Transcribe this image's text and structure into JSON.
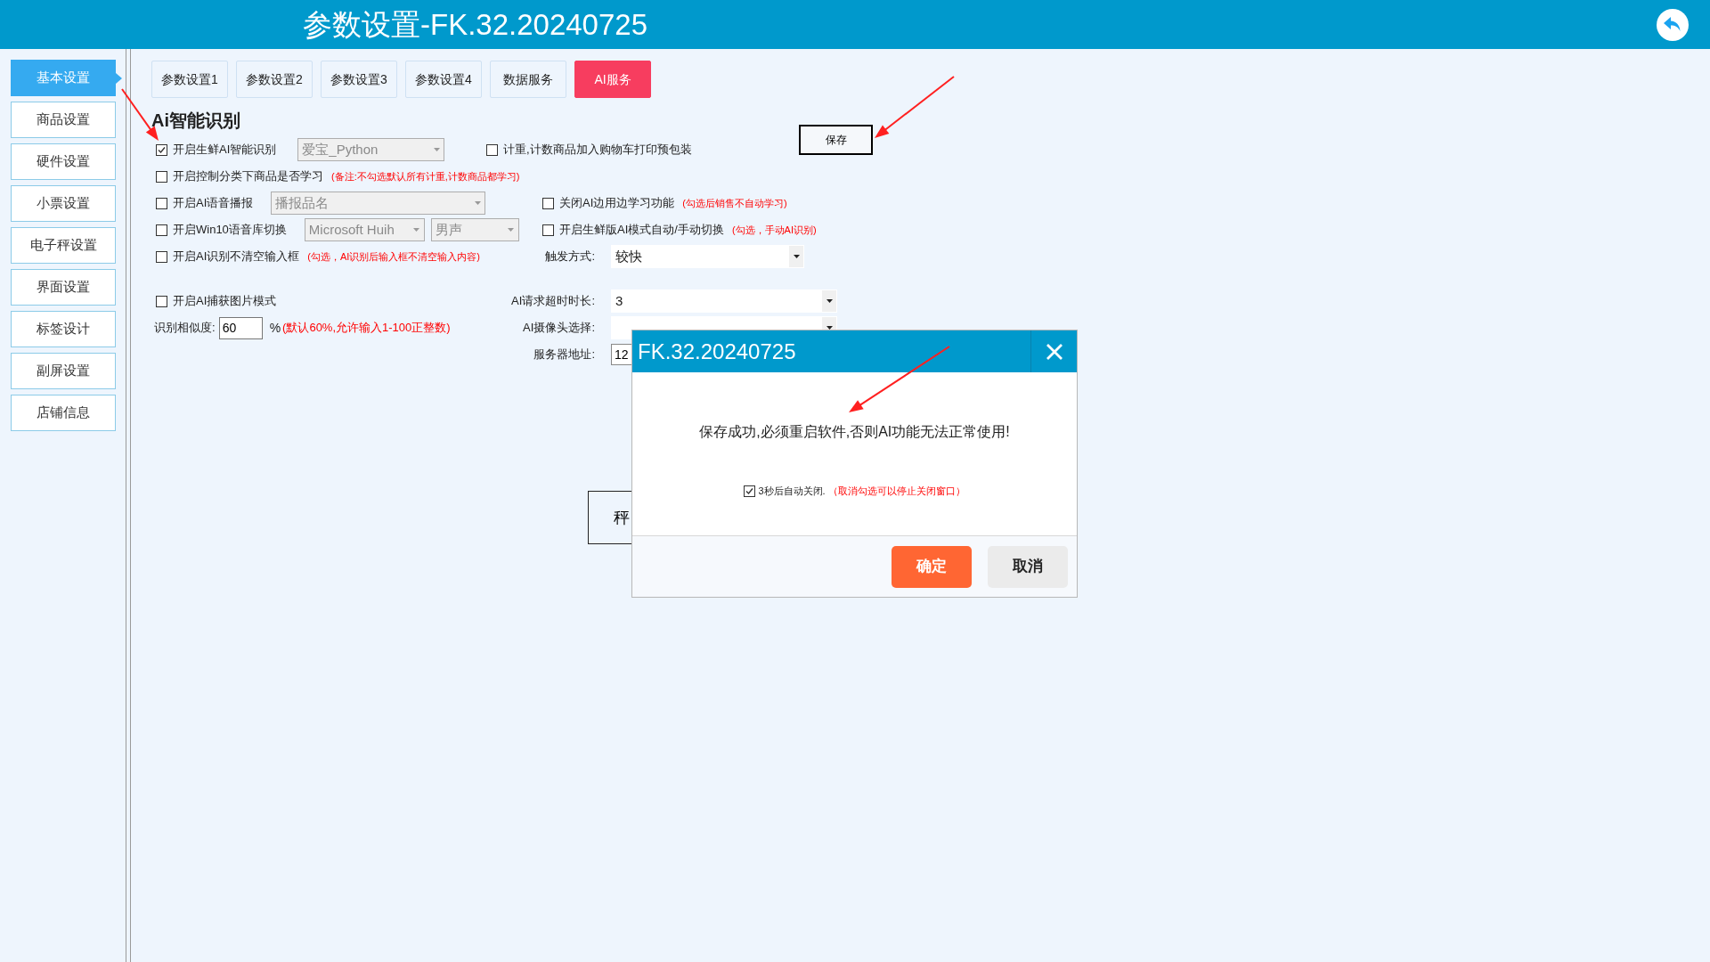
{
  "window": {
    "title": "参数设置-FK.32.20240725"
  },
  "sidebar": {
    "items": [
      {
        "label": "基本设置",
        "selected": true
      },
      {
        "label": "商品设置",
        "selected": false
      },
      {
        "label": "硬件设置",
        "selected": false
      },
      {
        "label": "小票设置",
        "selected": false
      },
      {
        "label": "电子秤设置",
        "selected": false
      },
      {
        "label": "界面设置",
        "selected": false
      },
      {
        "label": "标签设计",
        "selected": false
      },
      {
        "label": "副屏设置",
        "selected": false
      },
      {
        "label": "店铺信息",
        "selected": false
      }
    ]
  },
  "tabs": [
    {
      "label": "参数设置1",
      "selected": false
    },
    {
      "label": "参数设置2",
      "selected": false
    },
    {
      "label": "参数设置3",
      "selected": false
    },
    {
      "label": "参数设置4",
      "selected": false
    },
    {
      "label": "数据服务",
      "selected": false
    },
    {
      "label": "AI服务",
      "selected": true
    }
  ],
  "form": {
    "title": "Ai智能识别",
    "save_button": "保存",
    "rows": [
      {
        "left": {
          "kind": "checkbox",
          "label": "开启生鲜AI智能识别",
          "checked": true,
          "selects": [
            {
              "value": "爱宝_Python",
              "disabled": true
            }
          ]
        },
        "right": {
          "kind": "checkbox",
          "label": "计重,计数商品加入购物车打印预包装",
          "checked": false
        }
      },
      {
        "left": {
          "kind": "checkbox",
          "label": "开启控制分类下商品是否学习",
          "checked": false,
          "note": "(备注:不勾选默认所有计重,计数商品都学习)"
        }
      },
      {
        "left": {
          "kind": "checkbox",
          "label": "开启AI语音播报",
          "checked": false,
          "selects": [
            {
              "value": "播报品名",
              "disabled": true
            }
          ]
        },
        "right": {
          "kind": "checkbox",
          "label": "关闭AI边用边学习功能",
          "checked": false,
          "note": "(勾选后销售不自动学习)"
        }
      },
      {
        "left": {
          "kind": "checkbox",
          "label": "开启Win10语音库切换",
          "checked": false,
          "selects": [
            {
              "value": "Microsoft Huih",
              "disabled": true
            },
            {
              "value": "男声",
              "disabled": true
            }
          ]
        },
        "right": {
          "kind": "checkbox",
          "label": "开启生鲜版AI模式自动/手动切换",
          "checked": false,
          "note": "(勾选，手动AI识别)"
        }
      },
      {
        "left": {
          "kind": "checkbox",
          "label": "开启AI识别不清空输入框",
          "checked": false,
          "note": "(勾选，AI识别后输入框不清空输入内容)"
        },
        "right": {
          "kind": "select",
          "label": "触发方式:",
          "value": "较快"
        }
      },
      {
        "left": {
          "kind": "checkbox",
          "label": "开启AI捕获图片模式",
          "checked": false
        },
        "right": {
          "kind": "select",
          "label": "AI请求超时时长:",
          "value": "3"
        }
      },
      {
        "left": {
          "kind": "field",
          "label": "识别相似度:",
          "value": "60",
          "suffix": "%",
          "note": "(默认60%,允许输入1-100正整数)"
        },
        "right": {
          "kind": "select",
          "label": "AI摄像头选择:"
        }
      },
      {
        "right": {
          "kind": "field",
          "label": "服务器地址:",
          "value": "12"
        }
      }
    ],
    "scale_button": "秤"
  },
  "dialog": {
    "title": "FK.32.20240725",
    "message": "保存成功,必须重启软件,否则AI功能无法正常使用!",
    "auto_close": {
      "label": "3秒后自动关闭.",
      "checked": true,
      "note": "（取消勾选可以停止关闭窗口）"
    },
    "buttons": [
      {
        "label": "确定",
        "kind": "primary"
      },
      {
        "label": "取消",
        "kind": "secondary"
      }
    ]
  }
}
